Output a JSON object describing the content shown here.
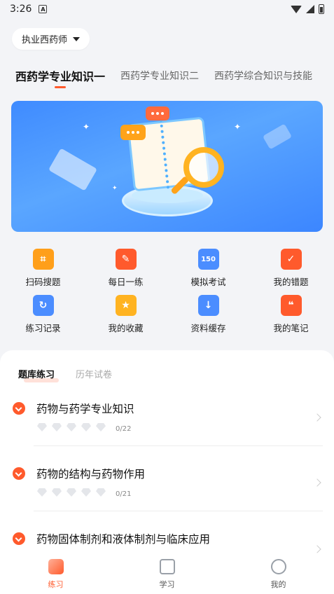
{
  "status_bar": {
    "time": "3:26",
    "notification_badge": "A"
  },
  "exam_selector": {
    "label": "执业西药师"
  },
  "subject_tabs": [
    {
      "label": "西药学专业知识一",
      "active": true
    },
    {
      "label": "西药学专业知识二",
      "active": false
    },
    {
      "label": "西药学综合知识与技能",
      "active": false
    }
  ],
  "grid_menu": [
    {
      "label": "扫码搜题",
      "icon": "scan-icon",
      "color": "#ff9f1a"
    },
    {
      "label": "每日一练",
      "icon": "daily-practice-icon",
      "color": "#ff5a2c"
    },
    {
      "label": "模拟考试",
      "icon": "mock-exam-icon",
      "color": "#4b8dff",
      "glyph": "150"
    },
    {
      "label": "我的错题",
      "icon": "wrong-questions-icon",
      "color": "#ff5a2c"
    },
    {
      "label": "练习记录",
      "icon": "practice-record-icon",
      "color": "#4b8dff"
    },
    {
      "label": "我的收藏",
      "icon": "favorites-icon",
      "color": "#ffb321"
    },
    {
      "label": "资料缓存",
      "icon": "download-cache-icon",
      "color": "#4b8dff"
    },
    {
      "label": "我的笔记",
      "icon": "notes-icon",
      "color": "#ff5a2c"
    }
  ],
  "practice_tabs": [
    {
      "label": "题库练习",
      "active": true
    },
    {
      "label": "历年试卷",
      "active": false
    }
  ],
  "chapters": [
    {
      "title": "药物与药学专业知识",
      "progress": "0/22",
      "stars": 5
    },
    {
      "title": "药物的结构与药物作用",
      "progress": "0/21",
      "stars": 5
    },
    {
      "title": "药物固体制剂和液体制剂与临床应用",
      "progress": "",
      "stars": 0
    }
  ],
  "bottom_nav": [
    {
      "label": "练习",
      "active": true
    },
    {
      "label": "学习",
      "active": false
    },
    {
      "label": "我的",
      "active": false
    }
  ],
  "colors": {
    "accent": "#ff5a2c",
    "blue": "#4b8dff",
    "background": "#f3f4f7"
  }
}
